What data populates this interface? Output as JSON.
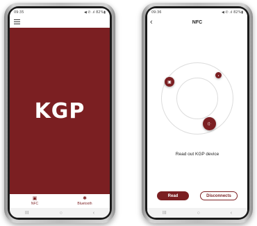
{
  "left_phone": {
    "status": {
      "time": "09:35",
      "icons": "◀ ✆ .ıl 82%▮"
    },
    "logo": "KGP",
    "tabs": [
      {
        "label": "NFC",
        "icon": "nfc-chip-icon",
        "glyph": "▣"
      },
      {
        "label": "Bluetooth",
        "icon": "bluetooth-icon",
        "glyph": "✱"
      }
    ],
    "nav": {
      "recents": "III",
      "home": "○",
      "back": "‹"
    }
  },
  "right_phone": {
    "status": {
      "time": "09:36",
      "icons": "◀ ✆ .ıl 82%▮"
    },
    "title": "NFC",
    "back_glyph": "‹",
    "device_glyphs": {
      "phone": "▣",
      "dot": "●",
      "nfc": "((·"
    },
    "message": "Read out KGP device",
    "read_button": "Read",
    "disconnect_button": "Disconnects",
    "nav": {
      "recents": "III",
      "home": "○",
      "back": "‹"
    }
  },
  "colors": {
    "brand": "#7b1f22",
    "background": "#ffffff",
    "ring": "#dcdcdc"
  }
}
